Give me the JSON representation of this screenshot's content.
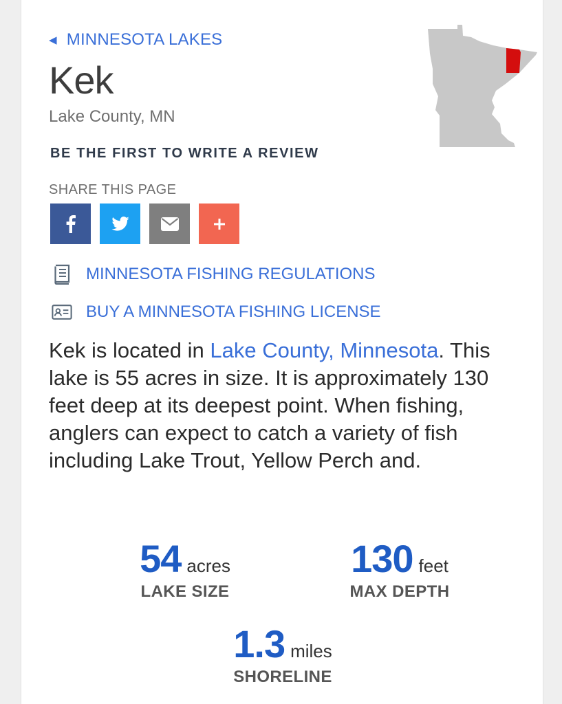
{
  "breadcrumb": {
    "label": "MINNESOTA LAKES"
  },
  "lake": {
    "name": "Kek",
    "location": "Lake County, MN"
  },
  "review": {
    "label": "BE THE FIRST TO WRITE A REVIEW"
  },
  "share": {
    "label": "SHARE THIS PAGE",
    "buttons": [
      {
        "name": "facebook",
        "icon": "facebook-icon",
        "color": "#3b5998"
      },
      {
        "name": "twitter",
        "icon": "twitter-icon",
        "color": "#1da1f2"
      },
      {
        "name": "email",
        "icon": "envelope-icon",
        "color": "#7f7f7f"
      },
      {
        "name": "more",
        "icon": "plus-icon",
        "color": "#f26651"
      }
    ]
  },
  "resources": {
    "regulations": "MINNESOTA FISHING REGULATIONS",
    "license": "BUY A MINNESOTA FISHING LICENSE"
  },
  "description": {
    "intro": "Kek is located in ",
    "county_link": "Lake County, Minnesota",
    "rest": ". This lake is 55 acres in size. It is approximately 130 feet deep at its deepest point. When fishing, anglers can expect to catch a variety of fish including Lake Trout, Yellow Perch and."
  },
  "stats": {
    "size": {
      "value": "54",
      "unit": "acres",
      "label": "LAKE SIZE"
    },
    "depth": {
      "value": "130",
      "unit": "feet",
      "label": "MAX DEPTH"
    },
    "shoreline": {
      "value": "1.3",
      "unit": "miles",
      "label": "SHORELINE"
    }
  },
  "colors": {
    "link": "#3a6fd8",
    "stat": "#1f5cc4",
    "map_fill": "#c8c8c8",
    "map_highlight": "#d40e0e"
  }
}
